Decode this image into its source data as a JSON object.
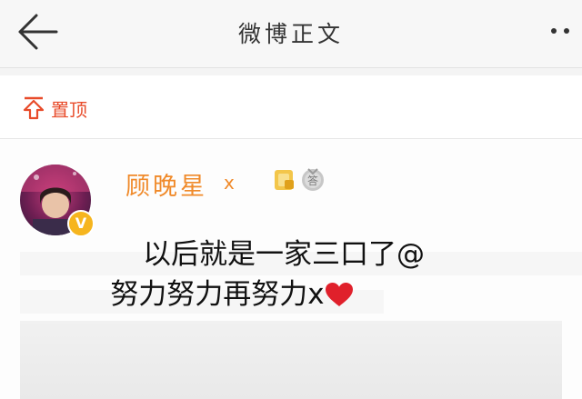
{
  "nav": {
    "title": "微博正文",
    "back_icon": "arrow-left-icon",
    "more_icon": "more-dots-icon"
  },
  "pin": {
    "label": "置顶",
    "icon": "pin-top-icon",
    "color": "#e84b2a"
  },
  "post": {
    "username": "顾晚星",
    "username_suffix": "x",
    "username_color": "#f08a2a",
    "avatar_icon": "avatar",
    "verified_icon": "verified-v-icon",
    "verified_mark": "V",
    "badges": [
      "level-badge-icon",
      "member-badge-icon"
    ],
    "member_badge_text": "答",
    "caption_lines": [
      "以后就是一家三口了@",
      "努力努力再努力x"
    ],
    "caption_emoji": "heart-icon",
    "accent": "#e0202b"
  }
}
